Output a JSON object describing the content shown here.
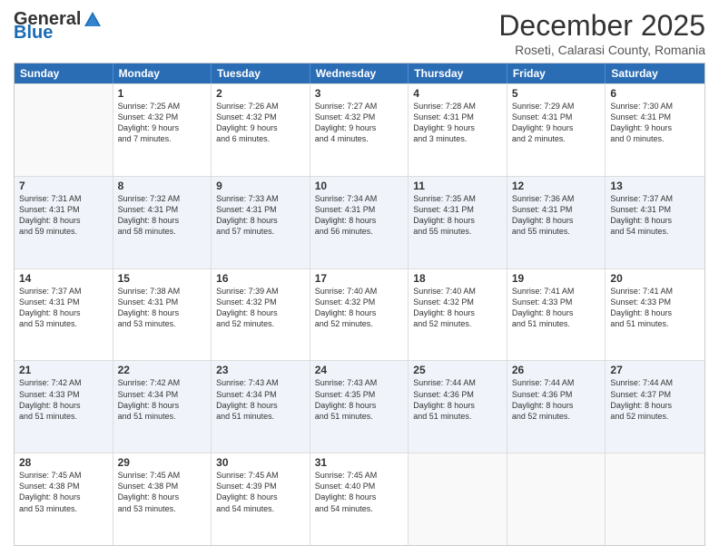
{
  "header": {
    "logo_general": "General",
    "logo_blue": "Blue",
    "month_title": "December 2025",
    "subtitle": "Roseti, Calarasi County, Romania"
  },
  "days_of_week": [
    "Sunday",
    "Monday",
    "Tuesday",
    "Wednesday",
    "Thursday",
    "Friday",
    "Saturday"
  ],
  "weeks": [
    [
      {
        "day": "",
        "empty": true
      },
      {
        "day": "1",
        "line1": "Sunrise: 7:25 AM",
        "line2": "Sunset: 4:32 PM",
        "line3": "Daylight: 9 hours",
        "line4": "and 7 minutes."
      },
      {
        "day": "2",
        "line1": "Sunrise: 7:26 AM",
        "line2": "Sunset: 4:32 PM",
        "line3": "Daylight: 9 hours",
        "line4": "and 6 minutes."
      },
      {
        "day": "3",
        "line1": "Sunrise: 7:27 AM",
        "line2": "Sunset: 4:32 PM",
        "line3": "Daylight: 9 hours",
        "line4": "and 4 minutes."
      },
      {
        "day": "4",
        "line1": "Sunrise: 7:28 AM",
        "line2": "Sunset: 4:31 PM",
        "line3": "Daylight: 9 hours",
        "line4": "and 3 minutes."
      },
      {
        "day": "5",
        "line1": "Sunrise: 7:29 AM",
        "line2": "Sunset: 4:31 PM",
        "line3": "Daylight: 9 hours",
        "line4": "and 2 minutes."
      },
      {
        "day": "6",
        "line1": "Sunrise: 7:30 AM",
        "line2": "Sunset: 4:31 PM",
        "line3": "Daylight: 9 hours",
        "line4": "and 0 minutes."
      }
    ],
    [
      {
        "day": "7",
        "line1": "Sunrise: 7:31 AM",
        "line2": "Sunset: 4:31 PM",
        "line3": "Daylight: 8 hours",
        "line4": "and 59 minutes."
      },
      {
        "day": "8",
        "line1": "Sunrise: 7:32 AM",
        "line2": "Sunset: 4:31 PM",
        "line3": "Daylight: 8 hours",
        "line4": "and 58 minutes."
      },
      {
        "day": "9",
        "line1": "Sunrise: 7:33 AM",
        "line2": "Sunset: 4:31 PM",
        "line3": "Daylight: 8 hours",
        "line4": "and 57 minutes."
      },
      {
        "day": "10",
        "line1": "Sunrise: 7:34 AM",
        "line2": "Sunset: 4:31 PM",
        "line3": "Daylight: 8 hours",
        "line4": "and 56 minutes."
      },
      {
        "day": "11",
        "line1": "Sunrise: 7:35 AM",
        "line2": "Sunset: 4:31 PM",
        "line3": "Daylight: 8 hours",
        "line4": "and 55 minutes."
      },
      {
        "day": "12",
        "line1": "Sunrise: 7:36 AM",
        "line2": "Sunset: 4:31 PM",
        "line3": "Daylight: 8 hours",
        "line4": "and 55 minutes."
      },
      {
        "day": "13",
        "line1": "Sunrise: 7:37 AM",
        "line2": "Sunset: 4:31 PM",
        "line3": "Daylight: 8 hours",
        "line4": "and 54 minutes."
      }
    ],
    [
      {
        "day": "14",
        "line1": "Sunrise: 7:37 AM",
        "line2": "Sunset: 4:31 PM",
        "line3": "Daylight: 8 hours",
        "line4": "and 53 minutes."
      },
      {
        "day": "15",
        "line1": "Sunrise: 7:38 AM",
        "line2": "Sunset: 4:31 PM",
        "line3": "Daylight: 8 hours",
        "line4": "and 53 minutes."
      },
      {
        "day": "16",
        "line1": "Sunrise: 7:39 AM",
        "line2": "Sunset: 4:32 PM",
        "line3": "Daylight: 8 hours",
        "line4": "and 52 minutes."
      },
      {
        "day": "17",
        "line1": "Sunrise: 7:40 AM",
        "line2": "Sunset: 4:32 PM",
        "line3": "Daylight: 8 hours",
        "line4": "and 52 minutes."
      },
      {
        "day": "18",
        "line1": "Sunrise: 7:40 AM",
        "line2": "Sunset: 4:32 PM",
        "line3": "Daylight: 8 hours",
        "line4": "and 52 minutes."
      },
      {
        "day": "19",
        "line1": "Sunrise: 7:41 AM",
        "line2": "Sunset: 4:33 PM",
        "line3": "Daylight: 8 hours",
        "line4": "and 51 minutes."
      },
      {
        "day": "20",
        "line1": "Sunrise: 7:41 AM",
        "line2": "Sunset: 4:33 PM",
        "line3": "Daylight: 8 hours",
        "line4": "and 51 minutes."
      }
    ],
    [
      {
        "day": "21",
        "line1": "Sunrise: 7:42 AM",
        "line2": "Sunset: 4:33 PM",
        "line3": "Daylight: 8 hours",
        "line4": "and 51 minutes."
      },
      {
        "day": "22",
        "line1": "Sunrise: 7:42 AM",
        "line2": "Sunset: 4:34 PM",
        "line3": "Daylight: 8 hours",
        "line4": "and 51 minutes."
      },
      {
        "day": "23",
        "line1": "Sunrise: 7:43 AM",
        "line2": "Sunset: 4:34 PM",
        "line3": "Daylight: 8 hours",
        "line4": "and 51 minutes."
      },
      {
        "day": "24",
        "line1": "Sunrise: 7:43 AM",
        "line2": "Sunset: 4:35 PM",
        "line3": "Daylight: 8 hours",
        "line4": "and 51 minutes."
      },
      {
        "day": "25",
        "line1": "Sunrise: 7:44 AM",
        "line2": "Sunset: 4:36 PM",
        "line3": "Daylight: 8 hours",
        "line4": "and 51 minutes."
      },
      {
        "day": "26",
        "line1": "Sunrise: 7:44 AM",
        "line2": "Sunset: 4:36 PM",
        "line3": "Daylight: 8 hours",
        "line4": "and 52 minutes."
      },
      {
        "day": "27",
        "line1": "Sunrise: 7:44 AM",
        "line2": "Sunset: 4:37 PM",
        "line3": "Daylight: 8 hours",
        "line4": "and 52 minutes."
      }
    ],
    [
      {
        "day": "28",
        "line1": "Sunrise: 7:45 AM",
        "line2": "Sunset: 4:38 PM",
        "line3": "Daylight: 8 hours",
        "line4": "and 53 minutes."
      },
      {
        "day": "29",
        "line1": "Sunrise: 7:45 AM",
        "line2": "Sunset: 4:38 PM",
        "line3": "Daylight: 8 hours",
        "line4": "and 53 minutes."
      },
      {
        "day": "30",
        "line1": "Sunrise: 7:45 AM",
        "line2": "Sunset: 4:39 PM",
        "line3": "Daylight: 8 hours",
        "line4": "and 54 minutes."
      },
      {
        "day": "31",
        "line1": "Sunrise: 7:45 AM",
        "line2": "Sunset: 4:40 PM",
        "line3": "Daylight: 8 hours",
        "line4": "and 54 minutes."
      },
      {
        "day": "",
        "empty": true
      },
      {
        "day": "",
        "empty": true
      },
      {
        "day": "",
        "empty": true
      }
    ]
  ]
}
